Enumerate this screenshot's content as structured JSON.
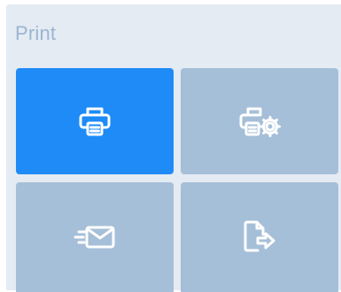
{
  "panel": {
    "title": "Print",
    "colors": {
      "background": "#e4ebf3",
      "title": "#9ab5d2",
      "tile_active": "#1e8bf7",
      "tile_default": "#a6bfd8",
      "icon": "#ffffff"
    },
    "tiles": [
      {
        "id": "print",
        "icon": "printer-icon",
        "active": true
      },
      {
        "id": "print-settings",
        "icon": "printer-settings-icon",
        "active": false
      },
      {
        "id": "email",
        "icon": "envelope-send-icon",
        "active": false
      },
      {
        "id": "export",
        "icon": "file-export-icon",
        "active": false
      }
    ]
  }
}
